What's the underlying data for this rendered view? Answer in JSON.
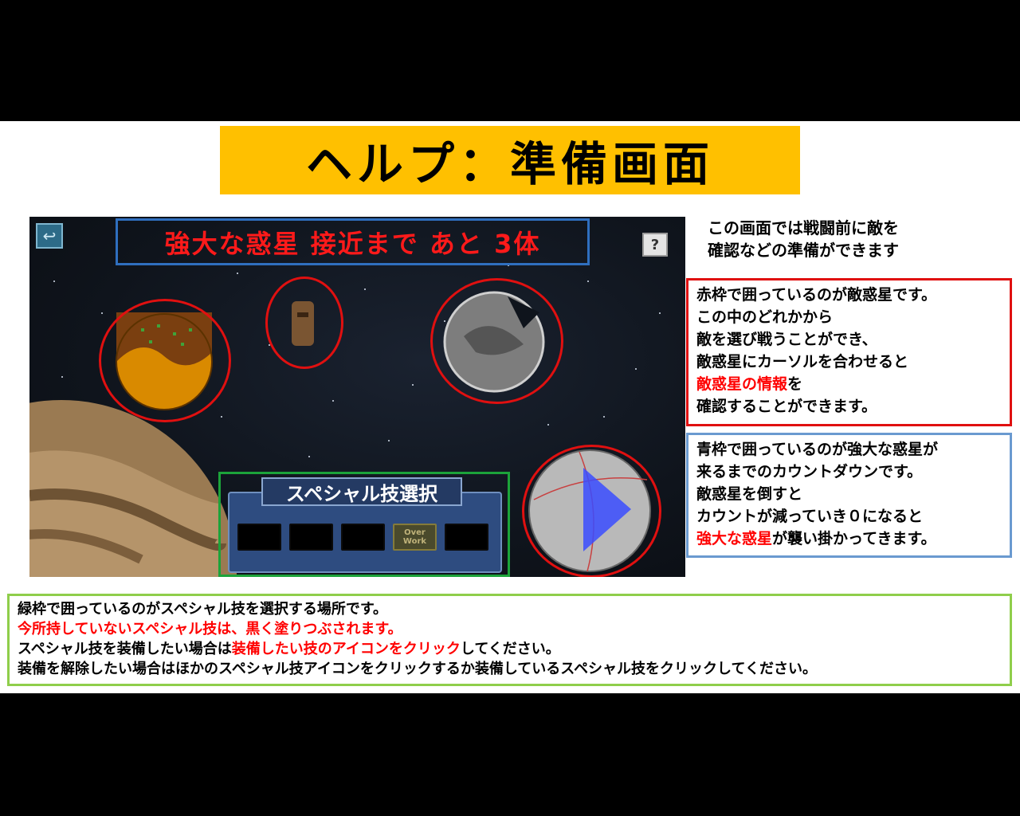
{
  "title": "ヘルプ：準備画面",
  "game": {
    "countdown_text": "強大な惑星 接近まで あと 3体",
    "help_button": "?",
    "back_icon": "↩",
    "special_select_title": "スペシャル技選択",
    "overwork_slot_label": "Over\nWork"
  },
  "intro_text": [
    "この画面では戦闘前に敵を",
    "確認などの準備ができます"
  ],
  "red_box": {
    "line1": "赤枠で囲っているのが敵惑星です。",
    "line2": "この中のどれかから",
    "line3": "敵を選び戦うことができ、",
    "line4": "敵惑星にカーソルを合わせると",
    "line5_red": "敵惑星の情報",
    "line5_rest": "を",
    "line6": "確認することができます。"
  },
  "blue_box": {
    "line1": "青枠で囲っているのが強大な惑星が",
    "line2": "来るまでのカウントダウンです。",
    "line3": "敵惑星を倒すと",
    "line4": "カウントが減っていき０になると",
    "line5_red": "強大な惑星",
    "line5_rest": "が襲い掛かってきます。"
  },
  "green_box": {
    "line1": "緑枠で囲っているのがスペシャル技を選択する場所です。",
    "line2_red": "今所持していないスペシャル技は、黒く塗りつぶされます。",
    "line3_a": "スペシャル技を装備したい場合は",
    "line3_red": "装備したい技のアイコンをクリック",
    "line3_b": "してください。",
    "line4": "装備を解除したい場合はほかのスペシャル技アイコンをクリックするか装備しているスペシャル技をクリックしてください。"
  },
  "colors": {
    "banner": "#ffc000",
    "red_frame": "#e01010",
    "blue_frame": "#2f6fbf",
    "green_frame": "#1ca33a",
    "highlight_text": "#ff0000"
  }
}
